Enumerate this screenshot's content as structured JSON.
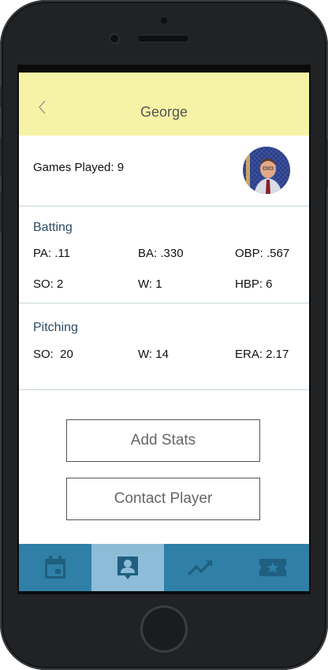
{
  "header": {
    "title": "George"
  },
  "profile": {
    "games_played": "Games Played: 9"
  },
  "batting": {
    "title": "Batting",
    "pa": "PA: .11",
    "ba": "BA: .330",
    "obp": "OBP: .567",
    "so": "SO: 2",
    "w": "W: 1",
    "hbp": "HBP: 6"
  },
  "pitching": {
    "title": "Pitching",
    "so": "SO:  20",
    "w": "W: 14",
    "era": "ERA: 2.17"
  },
  "actions": {
    "add_stats": "Add Stats",
    "contact_player": "Contact Player"
  },
  "tabs": [
    {
      "icon": "calendar-icon",
      "active": false
    },
    {
      "icon": "player-card-icon",
      "active": true
    },
    {
      "icon": "trend-icon",
      "active": false
    },
    {
      "icon": "ticket-icon",
      "active": false
    }
  ],
  "colors": {
    "header_bg": "#f6f3a6",
    "tabbar_bg": "#2f7fa7",
    "tab_active_bg": "#8cbcd7",
    "section_title": "#2b4b66"
  }
}
